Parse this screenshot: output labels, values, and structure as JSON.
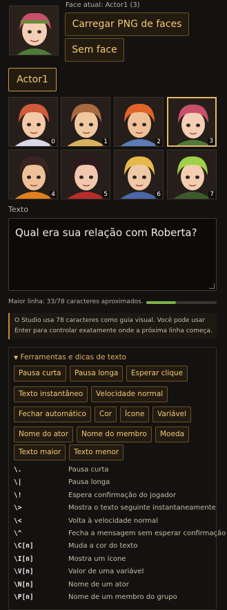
{
  "current_face": {
    "label": "Face atual: Actor1 (3)",
    "load_png_button": "Carregar PNG de faces",
    "no_face_button": "Sem face"
  },
  "actor_tab": "Actor1",
  "faces": [
    {
      "index": "0",
      "hair": "#d05a3c",
      "skin": "#f3c9a8",
      "accent": "#d8d8e8"
    },
    {
      "index": "1",
      "hair": "#a86a3e",
      "skin": "#f0c8a0",
      "accent": "#d9b260"
    },
    {
      "index": "2",
      "hair": "#e0642a",
      "skin": "#efc097",
      "accent": "#5c7bb8"
    },
    {
      "index": "3",
      "hair": "#c9506a",
      "skin": "#f4cfb6",
      "accent": "#4e7a3a"
    },
    {
      "index": "4",
      "hair": "#3a2420",
      "skin": "#eec09a",
      "accent": "#e08020"
    },
    {
      "index": "5",
      "hair": "#2e1a1e",
      "skin": "#f1c7ad",
      "accent": "#b82c2c"
    },
    {
      "index": "6",
      "hair": "#e6b84a",
      "skin": "#efc8a6",
      "accent": "#4a68a8"
    },
    {
      "index": "7",
      "hair": "#a0d048",
      "skin": "#f2cdb0",
      "accent": "#3c5a2c"
    }
  ],
  "text_section": {
    "label": "Texto",
    "value": "Qual era sua relação com Roberta?",
    "max_line": "Maior linha: 33/78 caracteres aproximados.",
    "progress": 0.42
  },
  "info_note": "O Studio usa 78 caracteres como guia visual. Você pode usar Enter para controlar exatamente onde a próxima linha começa.",
  "tools": {
    "title": "Ferramentas e dicas de texto",
    "buttons": [
      "Pausa curta",
      "Pausa longa",
      "Esperar clique",
      "Texto instantâneo",
      "Velocidade normal",
      "Fechar automático",
      "Cor",
      "Ícone",
      "Variável",
      "Nome do ator",
      "Nome do membro",
      "Moeda",
      "Texto maior",
      "Texto menor"
    ]
  },
  "codes": [
    {
      "code": "\\.",
      "desc": "Pausa curta"
    },
    {
      "code": "\\|",
      "desc": "Pausa longa"
    },
    {
      "code": "\\!",
      "desc": "Espera confirmação do jogador"
    },
    {
      "code": "\\>",
      "desc": "Mostra o texto seguinte instantaneamente"
    },
    {
      "code": "\\<",
      "desc": "Volta à velocidade normal"
    },
    {
      "code": "\\^",
      "desc": "Fecha a mensagem sem esperar confirmação"
    },
    {
      "code": "\\C[n]",
      "desc": "Muda a cor do texto"
    },
    {
      "code": "\\I[n]",
      "desc": "Mostra um ícone"
    },
    {
      "code": "\\V[n]",
      "desc": "Valor de uma variável"
    },
    {
      "code": "\\N[n]",
      "desc": "Nome de um ator"
    },
    {
      "code": "\\P[n]",
      "desc": "Nome de um membro do grupo"
    }
  ]
}
